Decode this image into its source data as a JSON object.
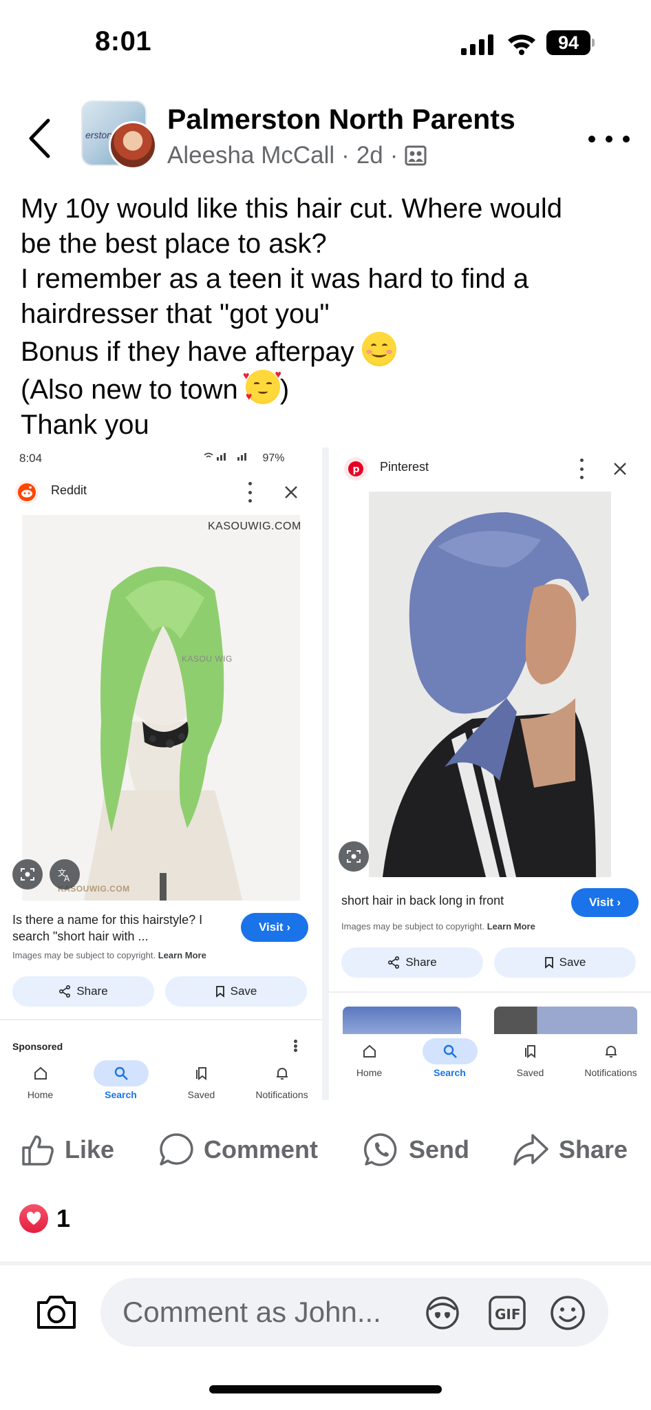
{
  "status_bar": {
    "time": "8:01",
    "battery": "94"
  },
  "post": {
    "group_name": "Palmerston North Parents",
    "author": "Aleesha McCall",
    "age": "2d",
    "sep": "·",
    "text_lines": [
      "My 10y would like this hair cut. Where would",
      "be the best place to ask?",
      "I remember as a teen it was hard to find a",
      "hairdresser that \"got you\"",
      "Bonus if they have afterpay",
      "(Also new to town",
      "Thank you"
    ],
    "paren_close": ")"
  },
  "screenshot_left": {
    "time": "8:04",
    "status_right": "97%",
    "source": "Reddit",
    "watermark_top": "KASOUWIG.COM",
    "watermark_mid": "KASOU WIG",
    "watermark_bottom": "KASOUWIG.COM",
    "caption": "Is there a name for this hairstyle? I search \"short hair with ...",
    "visit": "Visit ›",
    "copyright": "Images may be subject to copyright.",
    "learn_more": "Learn More",
    "share": "Share",
    "save": "Save",
    "sponsored": "Sponsored",
    "nav": [
      "Home",
      "Search",
      "Saved",
      "Notifications"
    ]
  },
  "screenshot_right": {
    "source": "Pinterest",
    "caption": "short hair in back long in front",
    "visit": "Visit ›",
    "copyright": "Images may be subject to copyright.",
    "learn_more": "Learn More",
    "share": "Share",
    "save": "Save",
    "nav": [
      "Home",
      "Search",
      "Saved",
      "Notifications"
    ]
  },
  "actions": {
    "like": "Like",
    "comment": "Comment",
    "send": "Send",
    "share": "Share"
  },
  "reactions": {
    "count": "1"
  },
  "comment_box": {
    "placeholder": "Comment as John..."
  },
  "colors": {
    "accent": "#1a73e8",
    "fb_gray": "#65676b",
    "heart": "#e41e3f"
  }
}
